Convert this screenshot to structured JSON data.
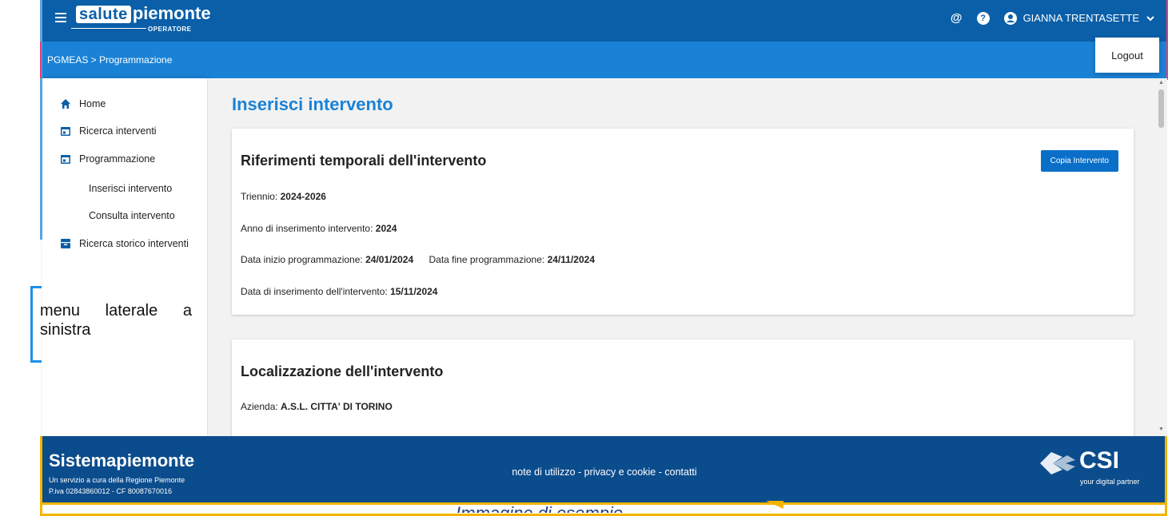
{
  "header": {
    "logo_salute": "salute",
    "logo_piemonte": "piemonte",
    "logo_sub": "OPERATORE",
    "user_name": "GIANNA TRENTASETTE",
    "logout": "Logout"
  },
  "breadcrumb": "PGMEAS > Programmazione",
  "sidebar": {
    "items": [
      {
        "label": "Home",
        "icon": "home-icon"
      },
      {
        "label": "Ricerca interventi",
        "icon": "calendar-icon"
      },
      {
        "label": "Programmazione",
        "icon": "calendar-icon"
      },
      {
        "label": "Inserisci intervento"
      },
      {
        "label": "Consulta intervento"
      },
      {
        "label": "Ricerca storico interventi",
        "icon": "archive-icon"
      }
    ]
  },
  "main": {
    "title": "Inserisci intervento",
    "card1": {
      "heading": "Riferimenti temporali dell'intervento",
      "button": "Copia Intervento",
      "triennio_label": "Triennio:",
      "triennio_value": "2024-2026",
      "anno_label": "Anno di inserimento intervento:",
      "anno_value": "2024",
      "inizio_label": "Data inizio programmazione:",
      "inizio_value": "24/01/2024",
      "fine_label": "Data fine programmazione:",
      "fine_value": "24/11/2024",
      "inserimento_label": "Data di inserimento dell'intervento:",
      "inserimento_value": "15/11/2024"
    },
    "card2": {
      "heading": "Localizzazione dell'intervento",
      "azienda_label": "Azienda:",
      "azienda_value": "A.S.L. CITTA' DI TORINO"
    }
  },
  "annotation": "menu laterale a sinistra",
  "footer": {
    "brand": "Sistemapiemonte",
    "line1": "Un servizio a cura della Regione Piemonte",
    "line2": "P.iva 02843860012 - CF 80087670016",
    "links": "note di utilizzo - privacy e cookie - contatti",
    "csi": "CSI",
    "csi_tag": "your digital partner"
  },
  "example_text": "Immagine di esempio",
  "colors": {
    "topbar": "#0a5fa8",
    "breadcrumb_bar": "#1a82d6",
    "title": "#1a82d6",
    "footer": "#0b4c8c",
    "annotation": "#1e90e8",
    "frame": "#f4b400"
  }
}
